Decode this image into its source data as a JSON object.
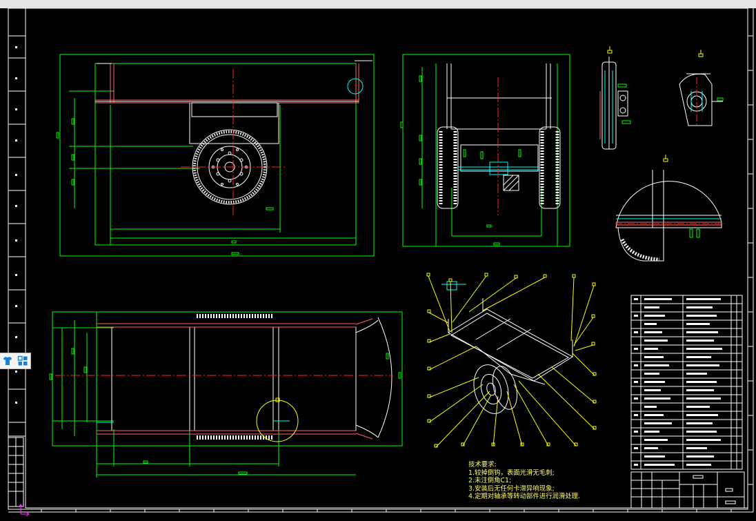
{
  "drawing": {
    "notes": {
      "title": "技术要求:",
      "lines": [
        "1.较掉倒钩，表面光滑无毛刺;",
        "2.未注倒角C1;",
        "3.安装后无任何卡滞异响现象;",
        "4.定期对轴承等转动部件进行润滑处理."
      ]
    }
  },
  "side_tools": {
    "items": [
      "shirt-icon",
      "grid-icon"
    ]
  },
  "colors": {
    "background": "#000000",
    "frame": "#ffffff",
    "dimension": "#00ff00",
    "centerline": "#ff0000",
    "leader": "#ffff00",
    "accent": "#1a7fd0"
  }
}
